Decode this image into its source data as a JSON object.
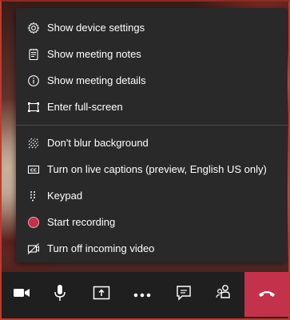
{
  "menu": {
    "items": [
      {
        "label": "Show device settings",
        "icon": "gear-icon"
      },
      {
        "label": "Show meeting notes",
        "icon": "notes-icon"
      },
      {
        "label": "Show meeting details",
        "icon": "info-icon"
      },
      {
        "label": "Enter full-screen",
        "icon": "fullscreen-icon"
      },
      {
        "label": "Don't blur background",
        "icon": "blur-icon"
      },
      {
        "label": "Turn on live captions (preview, English US only)",
        "icon": "captions-icon"
      },
      {
        "label": "Keypad",
        "icon": "keypad-icon"
      },
      {
        "label": "Start recording",
        "icon": "record-icon"
      },
      {
        "label": "Turn off incoming video",
        "icon": "video-off-icon"
      }
    ]
  },
  "toolbar": {
    "buttons": [
      "camera-icon",
      "microphone-icon",
      "share-screen-icon",
      "more-options-icon",
      "chat-icon",
      "participants-icon",
      "hang-up-icon"
    ]
  },
  "colors": {
    "menu_bg": "#292929",
    "toolbar_bg": "#1f1f1f",
    "hangup_red": "#c4314b",
    "record_red": "#c4314b",
    "text": "#ffffff"
  }
}
